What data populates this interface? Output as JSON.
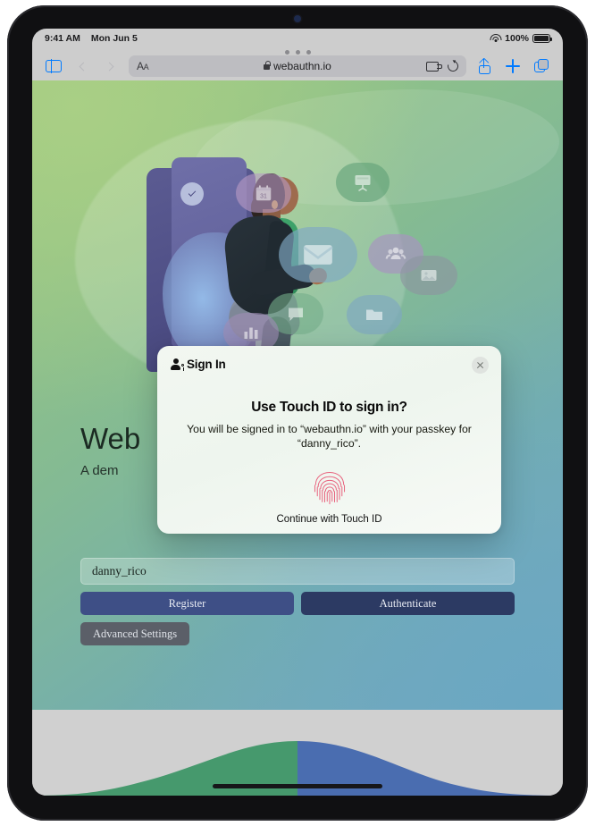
{
  "status_bar": {
    "time": "9:41 AM",
    "date": "Mon Jun 5",
    "wifi_icon": "wifi-icon",
    "battery_percent": "100%",
    "battery_icon": "battery-full-icon"
  },
  "browser": {
    "sidebar_icon": "sidebar-toggle-icon",
    "back_icon": "chevron-left-icon",
    "forward_icon": "chevron-right-icon",
    "text_size_label": "AA",
    "lock_icon": "lock-icon",
    "url": "webauthn.io",
    "reader_icon": "reader-view-icon",
    "reload_icon": "reload-icon",
    "share_icon": "share-icon",
    "new_tab_icon": "plus-icon",
    "tabs_icon": "tab-overview-icon"
  },
  "page": {
    "title": "Web",
    "subtitle": "A dem",
    "username_value": "danny_rico",
    "register_label": "Register",
    "authenticate_label": "Authenticate",
    "advanced_label": "Advanced Settings",
    "illustration": {
      "name": "person-stepping-through-door-illustration",
      "door_check_icon": "check-circle-icon",
      "bubbles": [
        {
          "icon": "calendar-icon",
          "label": "31",
          "color": "#b79ac4"
        },
        {
          "icon": "presentation-board-icon",
          "color": "#6aa885"
        },
        {
          "icon": "mail-envelope-icon",
          "color": "#7fa8c4"
        },
        {
          "icon": "people-group-icon",
          "color": "#a893c0"
        },
        {
          "icon": "photo-image-icon",
          "color": "#8b96a0"
        },
        {
          "icon": "chat-bubble-icon",
          "color": "#74ad8b"
        },
        {
          "icon": "folder-icon",
          "color": "#7fa8bf"
        },
        {
          "icon": "bar-chart-icon",
          "color": "#9e8db4"
        },
        {
          "icon": "chat-bubble-icon",
          "color": "#7fa3b6"
        }
      ]
    }
  },
  "modal": {
    "sign_in_icon": "person-key-icon",
    "sign_in_label": "Sign In",
    "close_icon": "close-icon",
    "heading": "Use Touch ID to sign in?",
    "body": "You will be signed in to “webauthn.io” with your passkey for “danny_rico”.",
    "touchid_icon": "fingerprint-icon",
    "touchid_caption": "Continue with Touch ID"
  },
  "colors": {
    "accent_blue": "#007aff",
    "touchid_pink": "#e8637e",
    "register_blue": "#3e4f86",
    "authenticate_blue": "#2c3a63",
    "footer_green": "#46996d",
    "footer_blue": "#4a6db0"
  },
  "footer": {
    "wave_green": "footer-wave-green",
    "wave_blue": "footer-wave-blue",
    "home_indicator": "home-indicator"
  }
}
